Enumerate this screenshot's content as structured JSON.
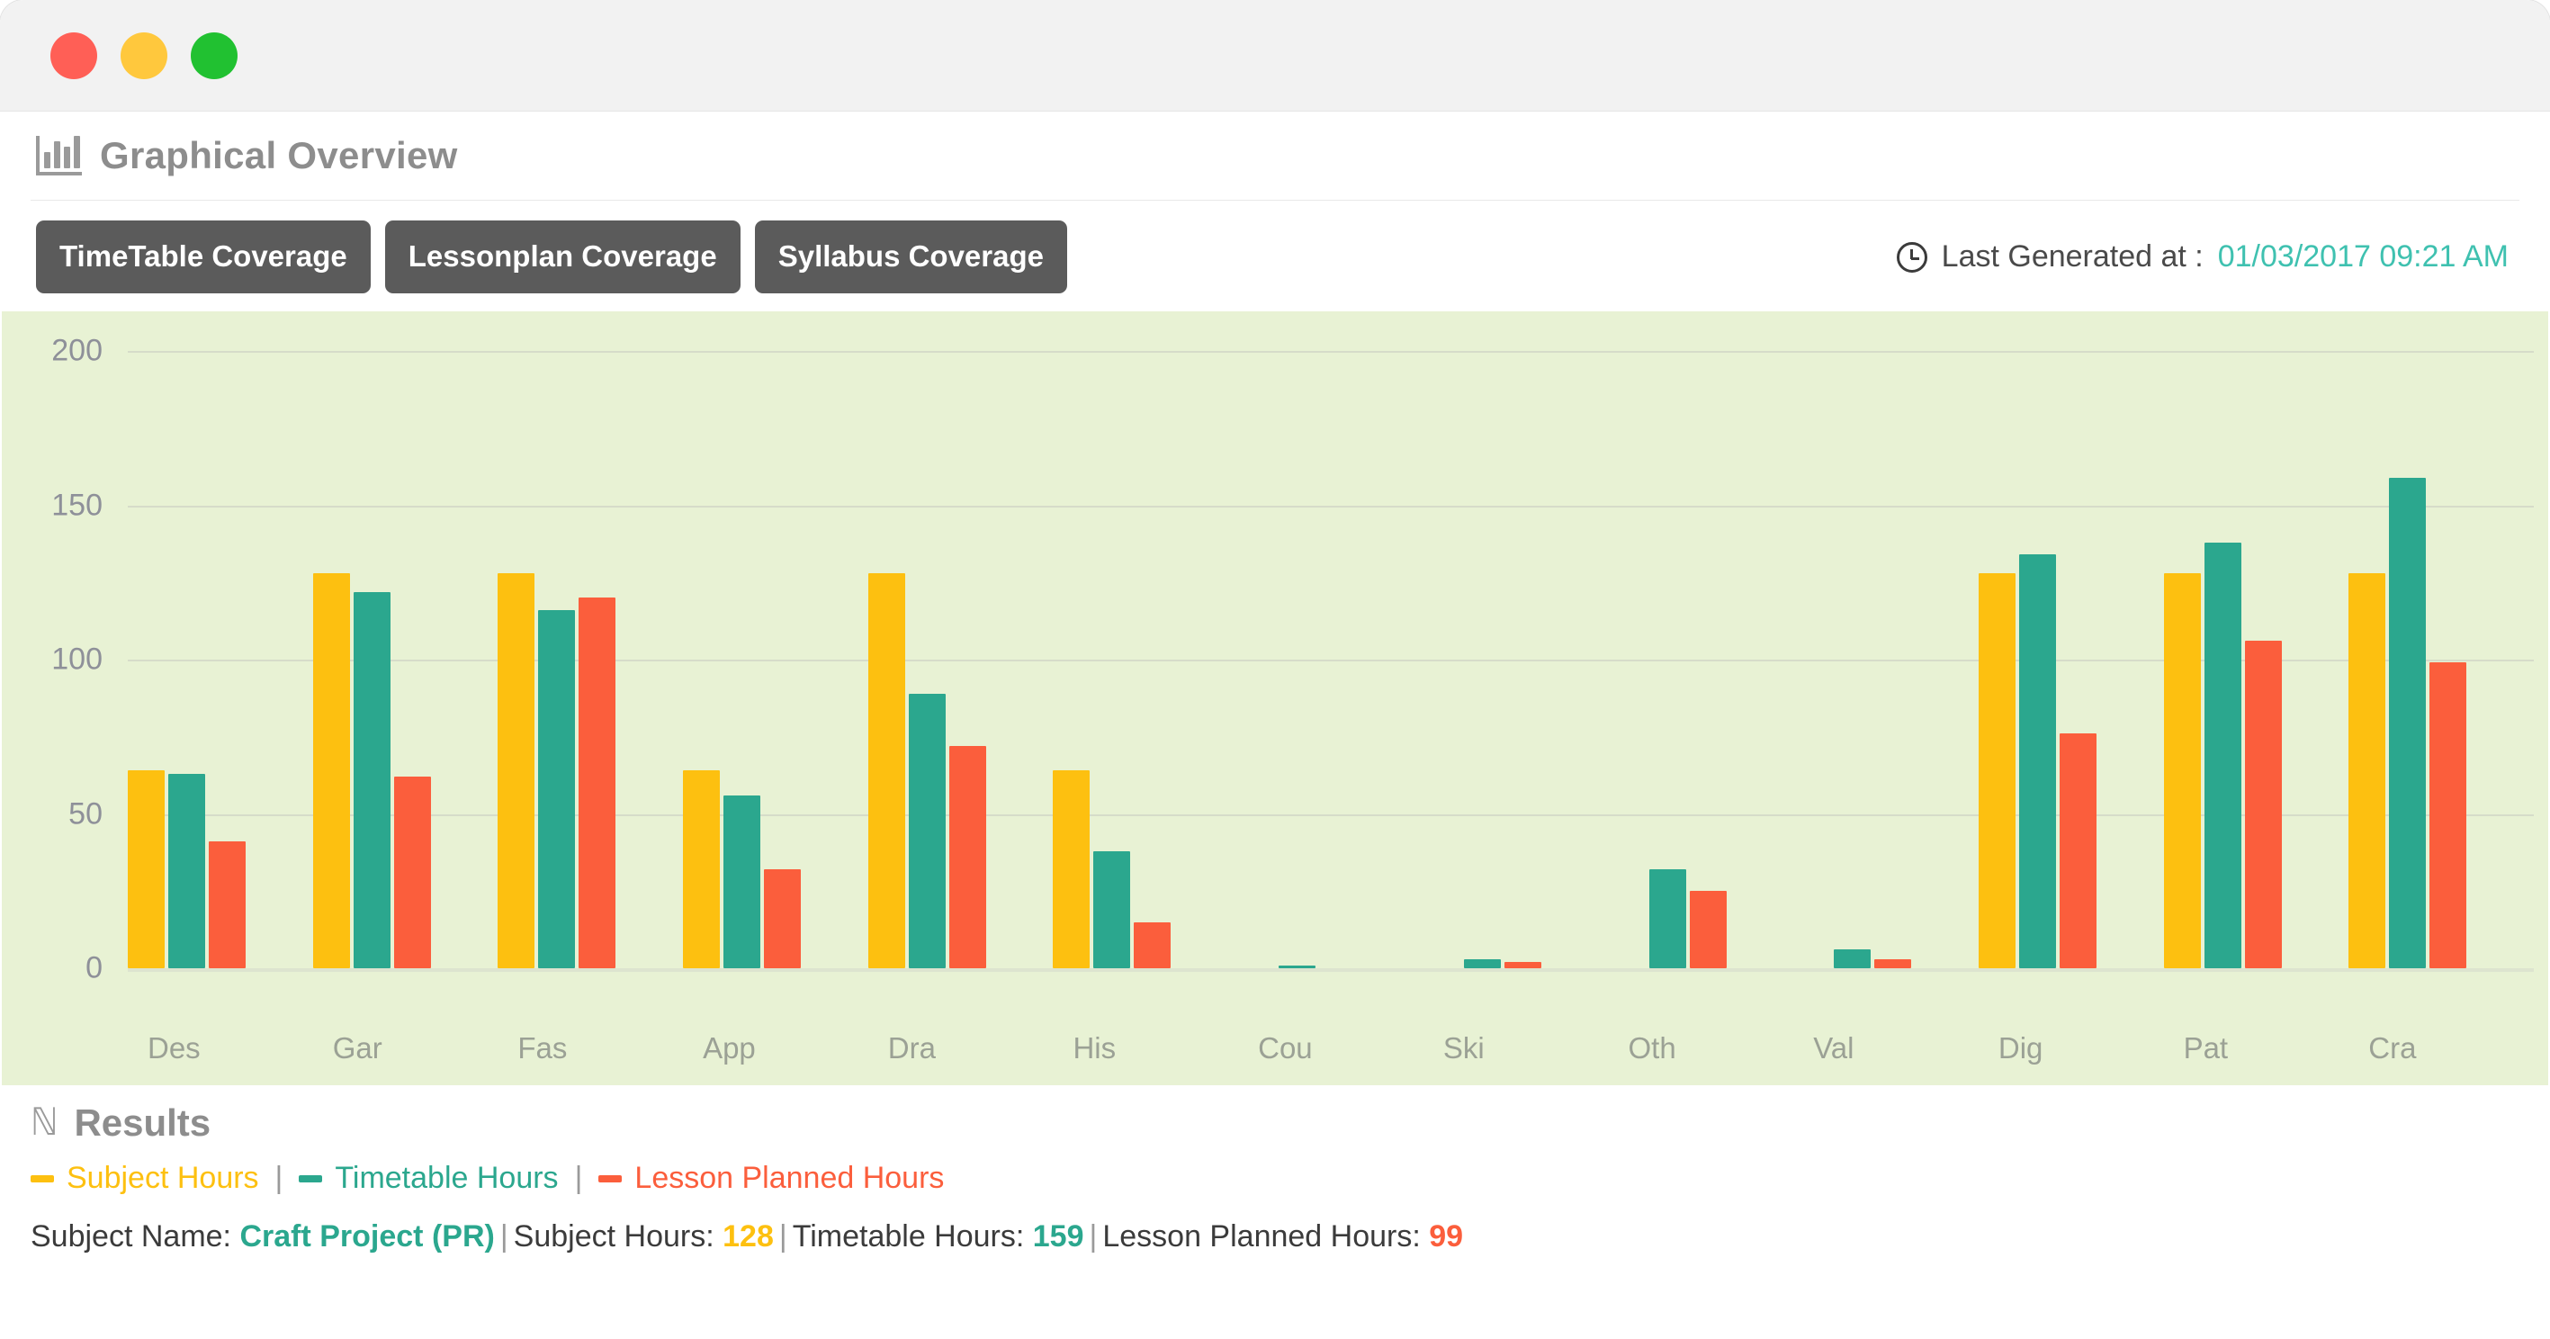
{
  "window": {
    "traffic_lights": [
      "close",
      "minimize",
      "maximize"
    ]
  },
  "panel": {
    "icon": "bar-chart-icon",
    "title": "Graphical Overview"
  },
  "tabs": [
    {
      "label": "TimeTable Coverage",
      "active": true
    },
    {
      "label": "Lessonplan Coverage",
      "active": false
    },
    {
      "label": "Syllabus Coverage",
      "active": false
    }
  ],
  "generated": {
    "icon": "clock-icon",
    "label": "Last Generated at :",
    "value": "01/03/2017 09:21 AM"
  },
  "results": {
    "icon": "results-icon",
    "title": "Results",
    "legend": [
      {
        "label": "Subject Hours",
        "color": "#fdc010"
      },
      {
        "label": "Timetable Hours",
        "color": "#2ba78e"
      },
      {
        "label": "Lesson Planned Hours",
        "color": "#fb5e3c"
      }
    ],
    "separator": "|",
    "summary": {
      "subject_name_label": "Subject Name:",
      "subject_name_value": "Craft Project (PR)",
      "subject_hours_label": "Subject Hours:",
      "subject_hours_value": "128",
      "timetable_hours_label": "Timetable Hours:",
      "timetable_hours_value": "159",
      "lesson_planned_hours_label": "Lesson Planned Hours:",
      "lesson_planned_hours_value": "99"
    }
  },
  "chart_data": {
    "type": "bar",
    "title": "",
    "xlabel": "",
    "ylabel": "",
    "ylim": [
      0,
      200
    ],
    "yticks": [
      0,
      50,
      100,
      150,
      200
    ],
    "grid": true,
    "legend_position": "below-chart",
    "plot_background": "#e8f2d4",
    "categories": [
      "Des",
      "Gar",
      "Fas",
      "App",
      "Dra",
      "His",
      "Cou",
      "Ski",
      "Oth",
      "Val",
      "Dig",
      "Pat",
      "Cra"
    ],
    "series": [
      {
        "name": "Subject Hours",
        "color": "#fdc010",
        "values": [
          64,
          128,
          128,
          64,
          128,
          64,
          0,
          0,
          0,
          0,
          128,
          128,
          128
        ]
      },
      {
        "name": "Timetable Hours",
        "color": "#2ba78e",
        "values": [
          63,
          122,
          116,
          56,
          89,
          38,
          1,
          3,
          32,
          6,
          134,
          138,
          159
        ]
      },
      {
        "name": "Lesson Planned Hours",
        "color": "#fb5e3c",
        "values": [
          41,
          62,
          120,
          32,
          72,
          15,
          0,
          2,
          25,
          3,
          76,
          106,
          99
        ]
      }
    ]
  }
}
